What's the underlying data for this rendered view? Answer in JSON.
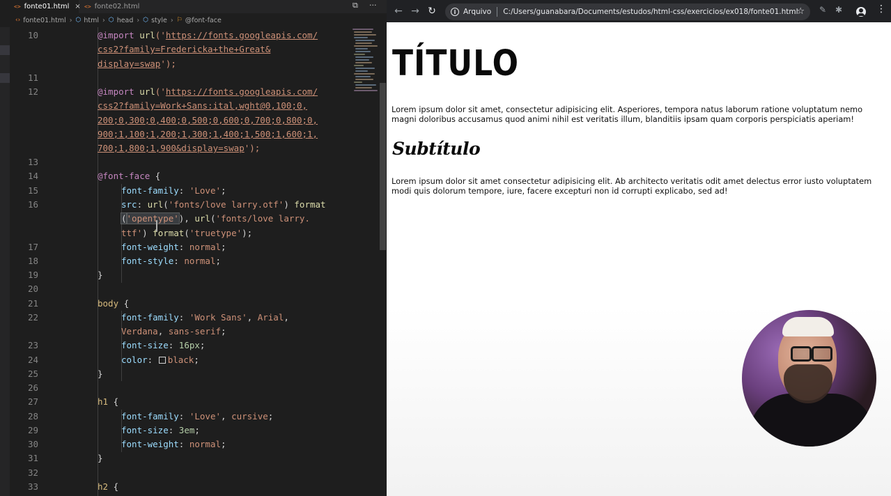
{
  "editor": {
    "tabs": [
      {
        "icon": "<>",
        "label": "fonte01.html",
        "active": true,
        "close": "×"
      },
      {
        "icon": "<>",
        "label": "fonte02.html",
        "active": false
      }
    ],
    "actions": {
      "split": "⧉",
      "more": "···"
    },
    "breadcrumb": [
      {
        "icon": "html-file-icon",
        "label": "fonte01.html"
      },
      {
        "icon": "tag-icon",
        "label": "html"
      },
      {
        "icon": "tag-icon",
        "label": "head"
      },
      {
        "icon": "tag-icon",
        "label": "style"
      },
      {
        "icon": "font-face-icon",
        "label": "@font-face"
      }
    ],
    "line_numbers": [
      "10",
      "11",
      "12",
      "13",
      "14",
      "15",
      "16",
      "17",
      "18",
      "19",
      "20",
      "21",
      "22",
      "23",
      "24",
      "25",
      "26",
      "27",
      "28",
      "29",
      "30",
      "31",
      "32",
      "33"
    ],
    "code": {
      "l10a_kw": "@import",
      "l10a_fn": "url",
      "l10a_p1": "('",
      "l10a_url": "https://fonts.googleapis.com/",
      "l10b_url": "css2?family=Fredericka+the+Great&",
      "l10c_url": "display=swap",
      "l10c_p": "');",
      "l12a_kw": "@import",
      "l12a_fn": "url",
      "l12a_p1": "('",
      "l12a_url": "https://fonts.googleapis.com/",
      "l12b_url": "css2?family=Work+Sans:ital,wght@0,100;0,",
      "l12c_url": "200;0,300;0,400;0,500;0,600;0,700;0,800;0,",
      "l12d_url": "900;1,100;1,200;1,300;1,400;1,500;1,600;1,",
      "l12e_url": "700;1,800;1,900&display=swap",
      "l12e_p": "');",
      "l14_sel": "@font-face",
      "l14_p": " {",
      "l15_prop": "font-family",
      "l15_p": ": ",
      "l15_val": "'Love'",
      "l15_end": ";",
      "l16a_prop": "src",
      "l16a_p": ": ",
      "l16a_fn": "url",
      "l16a_p2": "(",
      "l16a_str": "'fonts/love larry.otf'",
      "l16a_p3": ") ",
      "l16a_fn2": "format",
      "l16b_p": "(",
      "l16b_str": "'opentype'",
      "l16b_p2": "), ",
      "l16b_fn": "url",
      "l16b_p3": "(",
      "l16b_str2": "'fonts/love larry.",
      "l16c_str": "ttf'",
      "l16c_p": ") ",
      "l16c_fn": "format",
      "l16c_p2": "(",
      "l16c_str2": "'truetype'",
      "l16c_p3": ");",
      "l17_prop": "font-weight",
      "l17_p": ": ",
      "l17_val": "normal",
      "l17_end": ";",
      "l18_prop": "font-style",
      "l18_p": ": ",
      "l18_val": "normal",
      "l18_end": ";",
      "l19": "}",
      "l21_sel": "body",
      "l21_p": " {",
      "l22a_prop": "font-family",
      "l22a_p": ": ",
      "l22a_val": "'Work Sans'",
      "l22a_p2": ", ",
      "l22a_val2": "Arial",
      "l22b_val": "Verdana",
      "l22b_p": ", ",
      "l22b_val2": "sans-serif",
      "l22b_end": ";",
      "l23_prop": "font-size",
      "l23_p": ": ",
      "l23_num": "16px",
      "l23_end": ";",
      "l24_prop": "color",
      "l24_p": ": ",
      "l24_val": "black",
      "l24_end": ";",
      "l25": "}",
      "l27_sel": "h1",
      "l27_p": " {",
      "l28_prop": "font-family",
      "l28_p": ": ",
      "l28_val": "'Love'",
      "l28_p2": ", ",
      "l28_val2": "cursive",
      "l28_end": ";",
      "l29_prop": "font-size",
      "l29_p": ": ",
      "l29_num": "3em",
      "l29_end": ";",
      "l30_prop": "font-weight",
      "l30_p": ": ",
      "l30_val": "normal",
      "l30_end": ";",
      "l31": "}",
      "l33_sel": "h2",
      "l33_p": " {"
    },
    "colors": {
      "background": "#1e1e1e",
      "keyword": "#c586c0",
      "string": "#ce9178",
      "property": "#9cdcfe",
      "number": "#b5cea8",
      "selector": "#d7ba7d",
      "function": "#dcdcaa"
    }
  },
  "browser": {
    "nav": {
      "back": "←",
      "forward": "→",
      "reload": "↻"
    },
    "address": {
      "info": "i",
      "label": "Arquivo",
      "url": "C:/Users/guanabara/Documents/estudos/html-css/exercicios/ex018/fonte01.html",
      "star": "☆"
    },
    "toolbar_icons": {
      "edit": "✎",
      "extensions": "✱",
      "menu": "⋮"
    },
    "page": {
      "h1": "TÍTULO",
      "p1": "Lorem ipsum dolor sit amet, consectetur adipisicing elit. Asperiores, tempora natus laborum ratione voluptatum nemo magni doloribus accusamus quod animi nihil est veritatis illum, blanditiis ipsam quam corporis perspiciatis aperiam!",
      "h2": "Subtítulo",
      "p2": "Lorem ipsum dolor sit amet consectetur adipisicing elit. Ab architecto veritatis odit amet delectus error iusto voluptatem modi quis dolorum tempore, iure, facere excepturi non id corrupti explicabo, sed ad!"
    }
  }
}
